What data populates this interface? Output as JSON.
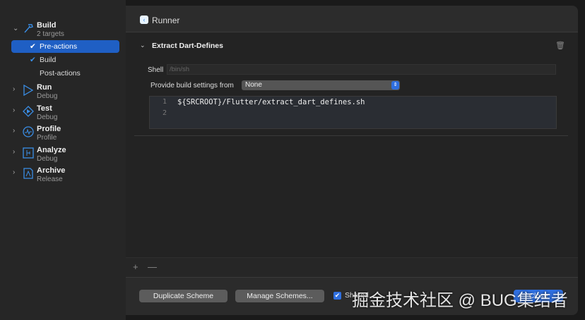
{
  "sidebar": {
    "build": {
      "title": "Build",
      "subtitle": "2 targets",
      "items": [
        {
          "label": "Pre-actions",
          "checked": true,
          "selected": true
        },
        {
          "label": "Build",
          "checked": true
        },
        {
          "label": "Post-actions",
          "checked": false
        }
      ]
    },
    "groups": [
      {
        "title": "Run",
        "subtitle": "Debug"
      },
      {
        "title": "Test",
        "subtitle": "Debug"
      },
      {
        "title": "Profile",
        "subtitle": "Profile"
      },
      {
        "title": "Analyze",
        "subtitle": "Debug"
      },
      {
        "title": "Archive",
        "subtitle": "Release"
      }
    ]
  },
  "header": {
    "target": "Runner"
  },
  "action": {
    "title": "Extract Dart-Defines",
    "shell_label": "Shell",
    "shell_placeholder": "/bin/sh",
    "provide_label": "Provide build settings from",
    "provide_value": "None",
    "lines": [
      "1",
      "2"
    ],
    "script": "${SRCROOT}/Flutter/extract_dart_defines.sh"
  },
  "toolbar": {
    "add": "+",
    "remove": "—"
  },
  "footer": {
    "duplicate": "Duplicate Scheme",
    "manage": "Manage Schemes...",
    "shared": "Shared",
    "close": "Close"
  },
  "watermark": "掘金技术社区 @ BUG集结者",
  "colors": {
    "accent": "#2f6fe0",
    "selection": "#1f5fc4"
  }
}
